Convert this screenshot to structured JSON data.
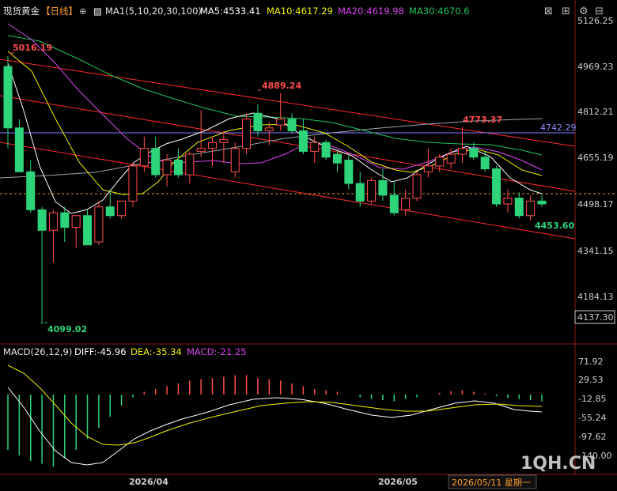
{
  "header": {
    "title": "现货黄金",
    "period": "【日线】",
    "ma_set": "MA1(5,10,20,30,100)",
    "ma5": "MA5:4533.41",
    "ma10": "MA10:4617.29",
    "ma20": "MA20:4619.98",
    "ma30": "MA30:4670.6"
  },
  "macd_header": {
    "name": "MACD(26,12,9)",
    "diff": "DIFF:-45.96",
    "dea": "DEA:-35.34",
    "macd": "MACD:-21.25"
  },
  "price_axis": [
    "5126.25",
    "4969.23",
    "4812.21",
    "4655.19",
    "4498.17",
    "4341.15",
    "4184.13"
  ],
  "macd_axis": [
    "71.92",
    "29.53",
    "-12.85",
    "-55.24",
    "-97.62",
    "-140.00"
  ],
  "date_labels": [
    "2026/04",
    "2026/05"
  ],
  "cursor_date": "2026/05/11 星期一",
  "last_price_tag": "4137.30",
  "hline_tag": "4742.29",
  "watermark": "1QH.CN",
  "colors": {
    "up": "#ff4d4d",
    "down": "#2ed47a",
    "ma5": "#ffffff",
    "ma10": "#f2f200",
    "ma20": "#d946ef",
    "ma30": "#22c55e",
    "ma100": "#9ca3af",
    "channel": "#ff2a2a",
    "hline": "#7b7bff"
  },
  "chart_data": {
    "type": "candlestick",
    "annotations": {
      "high_label": "5016.19",
      "low_label": "4099.02",
      "peak1": "4889.24",
      "peak2": "4773.37",
      "recent_low": "4453.60"
    },
    "candles": [
      [
        4980,
        5016,
        4700,
        4770
      ],
      [
        4770,
        4800,
        4620,
        4620
      ],
      [
        4620,
        4660,
        4480,
        4490
      ],
      [
        4490,
        4500,
        4099,
        4420
      ],
      [
        4420,
        4490,
        4310,
        4480
      ],
      [
        4480,
        4500,
        4380,
        4430
      ],
      [
        4430,
        4470,
        4360,
        4470
      ],
      [
        4470,
        4490,
        4370,
        4370
      ],
      [
        4380,
        4520,
        4370,
        4500
      ],
      [
        4500,
        4560,
        4460,
        4470
      ],
      [
        4470,
        4520,
        4460,
        4520
      ],
      [
        4520,
        4650,
        4500,
        4640
      ],
      [
        4640,
        4740,
        4620,
        4700
      ],
      [
        4700,
        4740,
        4600,
        4610
      ],
      [
        4610,
        4680,
        4570,
        4660
      ],
      [
        4660,
        4700,
        4600,
        4610
      ],
      [
        4610,
        4690,
        4580,
        4680
      ],
      [
        4690,
        4830,
        4670,
        4700
      ],
      [
        4700,
        4740,
        4640,
        4720
      ],
      [
        4720,
        4760,
        4650,
        4730
      ],
      [
        4620,
        4720,
        4600,
        4700
      ],
      [
        4700,
        4820,
        4680,
        4800
      ],
      [
        4820,
        4850,
        4740,
        4760
      ],
      [
        4760,
        4790,
        4710,
        4770
      ],
      [
        4780,
        4889,
        4760,
        4800
      ],
      [
        4800,
        4820,
        4750,
        4760
      ],
      [
        4760,
        4800,
        4680,
        4690
      ],
      [
        4690,
        4740,
        4650,
        4720
      ],
      [
        4720,
        4730,
        4660,
        4670
      ],
      [
        4680,
        4690,
        4620,
        4650
      ],
      [
        4660,
        4680,
        4560,
        4580
      ],
      [
        4580,
        4620,
        4500,
        4520
      ],
      [
        4520,
        4600,
        4510,
        4590
      ],
      [
        4590,
        4630,
        4520,
        4540
      ],
      [
        4540,
        4590,
        4470,
        4480
      ],
      [
        4490,
        4560,
        4470,
        4530
      ],
      [
        4530,
        4620,
        4520,
        4610
      ],
      [
        4620,
        4700,
        4600,
        4640
      ],
      [
        4640,
        4680,
        4620,
        4670
      ],
      [
        4650,
        4700,
        4630,
        4680
      ],
      [
        4680,
        4773,
        4650,
        4700
      ],
      [
        4700,
        4720,
        4660,
        4670
      ],
      [
        4670,
        4690,
        4620,
        4630
      ],
      [
        4630,
        4640,
        4500,
        4510
      ],
      [
        4510,
        4560,
        4480,
        4530
      ],
      [
        4530,
        4550,
        4460,
        4470
      ],
      [
        4470,
        4540,
        4454,
        4520
      ],
      [
        4520,
        4540,
        4500,
        4510
      ]
    ],
    "ma_values": {
      "MA5": 4533.41,
      "MA10": 4617.29,
      "MA20": 4619.98,
      "MA30": 4670.6
    },
    "macd": {
      "DIFF": -45.96,
      "DEA": -35.34,
      "MACD": -21.25
    },
    "price_range": [
      4137.3,
      5126.25
    ],
    "macd_range": [
      -140,
      71.92
    ]
  }
}
